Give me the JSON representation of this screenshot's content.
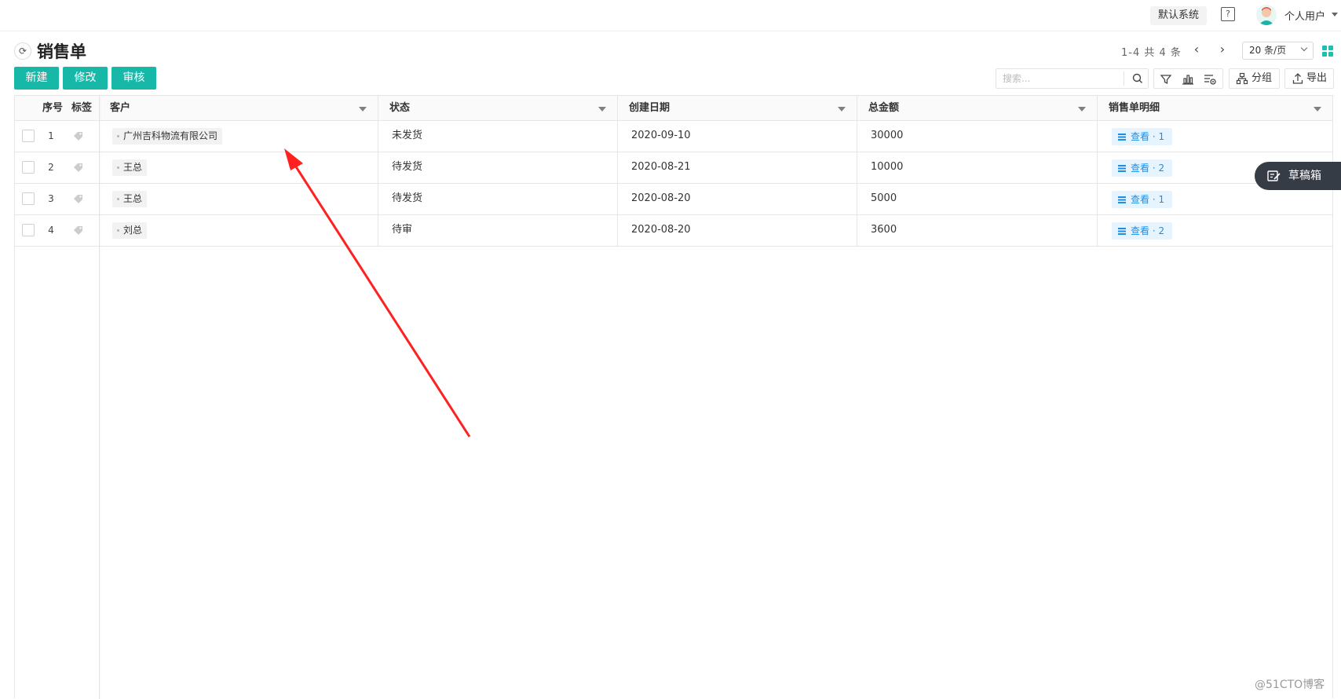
{
  "topbar": {
    "system_button": "默认系统",
    "help_icon": "?",
    "user_name": "个人用户"
  },
  "page": {
    "title": "销售单"
  },
  "pager": {
    "summary": "1-4 共 4 条",
    "prev": "‹",
    "next": "›",
    "page_size": "20 条/页"
  },
  "toolbar": {
    "new_label": "新建",
    "edit_label": "修改",
    "audit_label": "审核",
    "search_placeholder": "搜索...",
    "group_label": "分组",
    "export_label": "导出"
  },
  "table": {
    "fixed_headers": {
      "index": "序号",
      "tag": "标签"
    },
    "columns": [
      "客户",
      "状态",
      "创建日期",
      "总金额",
      "销售单明细"
    ],
    "rows": [
      {
        "index": "1",
        "customer": "广州吉科物流有限公司",
        "status": "未发货",
        "date": "2020-09-10",
        "amount": "30000",
        "detail": "查看 · 1"
      },
      {
        "index": "2",
        "customer": "王总",
        "status": "待发货",
        "date": "2020-08-21",
        "amount": "10000",
        "detail": "查看 · 2"
      },
      {
        "index": "3",
        "customer": "王总",
        "status": "待发货",
        "date": "2020-08-20",
        "amount": "5000",
        "detail": "查看 · 1"
      },
      {
        "index": "4",
        "customer": "刘总",
        "status": "待审",
        "date": "2020-08-20",
        "amount": "3600",
        "detail": "查看 · 2"
      }
    ]
  },
  "drafts": {
    "label": "草稿箱"
  },
  "watermark": "@51CTO博客",
  "colors": {
    "accent": "#17b8a8",
    "link": "#1b8fe6",
    "arrow": "#ff2020",
    "drafts_bg": "#363c46"
  }
}
